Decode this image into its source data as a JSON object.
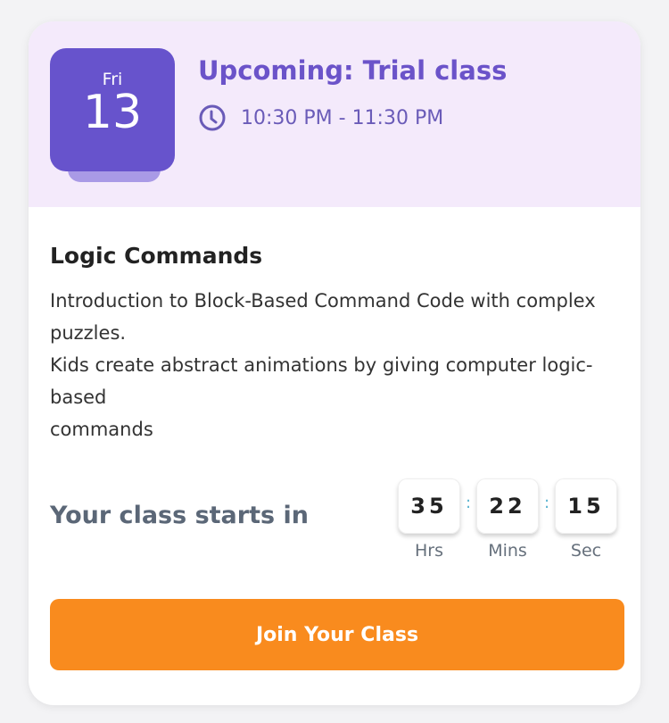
{
  "date": {
    "weekday": "Fri",
    "day": "13"
  },
  "header": {
    "title": "Upcoming: Trial class",
    "time": "10:30 PM - 11:30 PM"
  },
  "course": {
    "name": "Logic Commands",
    "description": "Introduction to Block-Based Command Code with complex\npuzzles.\nKids create abstract animations by giving computer logic-\nbased\ncommands"
  },
  "countdown": {
    "label": "Your class starts in",
    "hours": "35",
    "minutes": "22",
    "seconds": "15",
    "hours_label": "Hrs",
    "minutes_label": "Mins",
    "seconds_label": "Sec",
    "separator": ":"
  },
  "join_button": "Join Your Class"
}
